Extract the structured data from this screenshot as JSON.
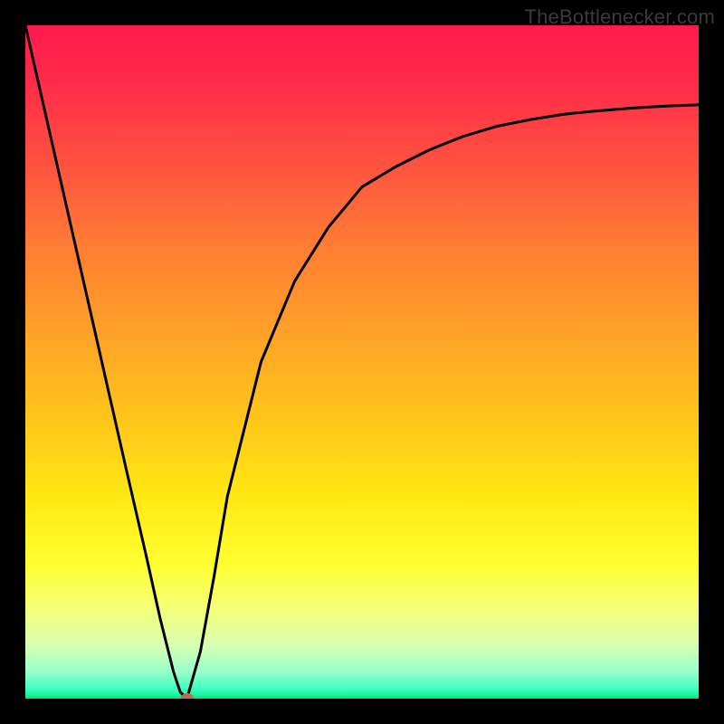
{
  "watermark": "TheBottlenecker.com",
  "chart_data": {
    "type": "line",
    "title": "",
    "xlabel": "",
    "ylabel": "",
    "xlim": [
      0,
      100
    ],
    "ylim": [
      0,
      100
    ],
    "x": [
      0,
      5,
      10,
      15,
      18,
      20,
      22,
      23,
      24,
      26,
      28,
      30,
      35,
      40,
      45,
      50,
      55,
      60,
      65,
      70,
      75,
      80,
      85,
      90,
      95,
      100
    ],
    "values": [
      100,
      78,
      56,
      34,
      21,
      12,
      4,
      1,
      0,
      7,
      18,
      30,
      50,
      62,
      70,
      76,
      79,
      81.5,
      83.5,
      85,
      86,
      86.8,
      87.3,
      87.7,
      88,
      88.2
    ],
    "optimal_x": 24,
    "marker": {
      "x": 24,
      "y": 0
    }
  },
  "colors": {
    "curve": "#000000",
    "marker": "#c06a52",
    "frame": "#000000"
  }
}
